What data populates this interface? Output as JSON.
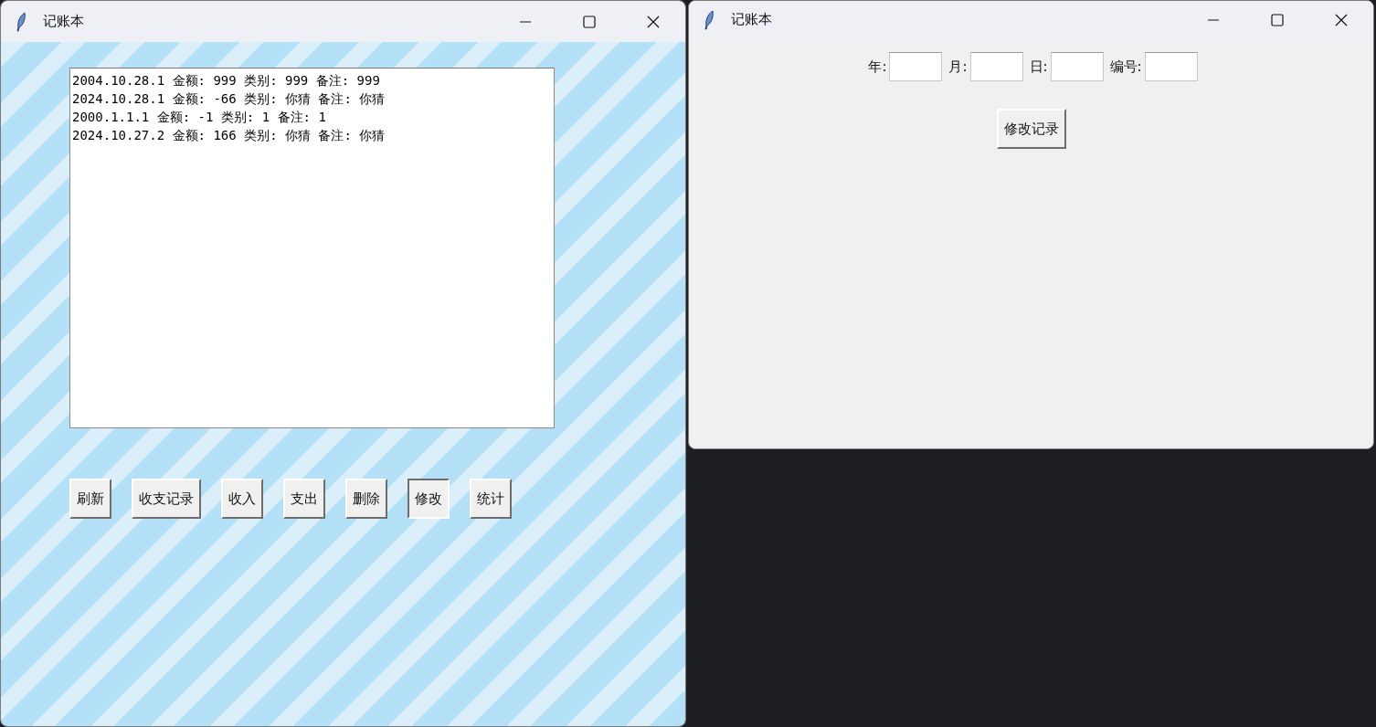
{
  "main_window": {
    "title": "记账本",
    "records": [
      "2004.10.28.1 金额: 999 类别: 999 备注: 999",
      "2024.10.28.1 金额: -66 类别: 你猜 备注: 你猜",
      "2000.1.1.1 金额: -1 类别: 1 备注: 1",
      "2024.10.27.2 金额: 166 类别: 你猜 备注: 你猜"
    ],
    "buttons": [
      {
        "label": "刷新",
        "selected": false
      },
      {
        "label": "收支记录",
        "selected": false
      },
      {
        "label": "收入",
        "selected": false
      },
      {
        "label": "支出",
        "selected": false
      },
      {
        "label": "删除",
        "selected": false
      },
      {
        "label": "修改",
        "selected": true
      },
      {
        "label": "统计",
        "selected": false
      }
    ]
  },
  "edit_window": {
    "title": "记账本",
    "fields": [
      {
        "label": "年:"
      },
      {
        "label": "月:"
      },
      {
        "label": "日:"
      },
      {
        "label": "编号:"
      }
    ],
    "button": "修改记录"
  }
}
